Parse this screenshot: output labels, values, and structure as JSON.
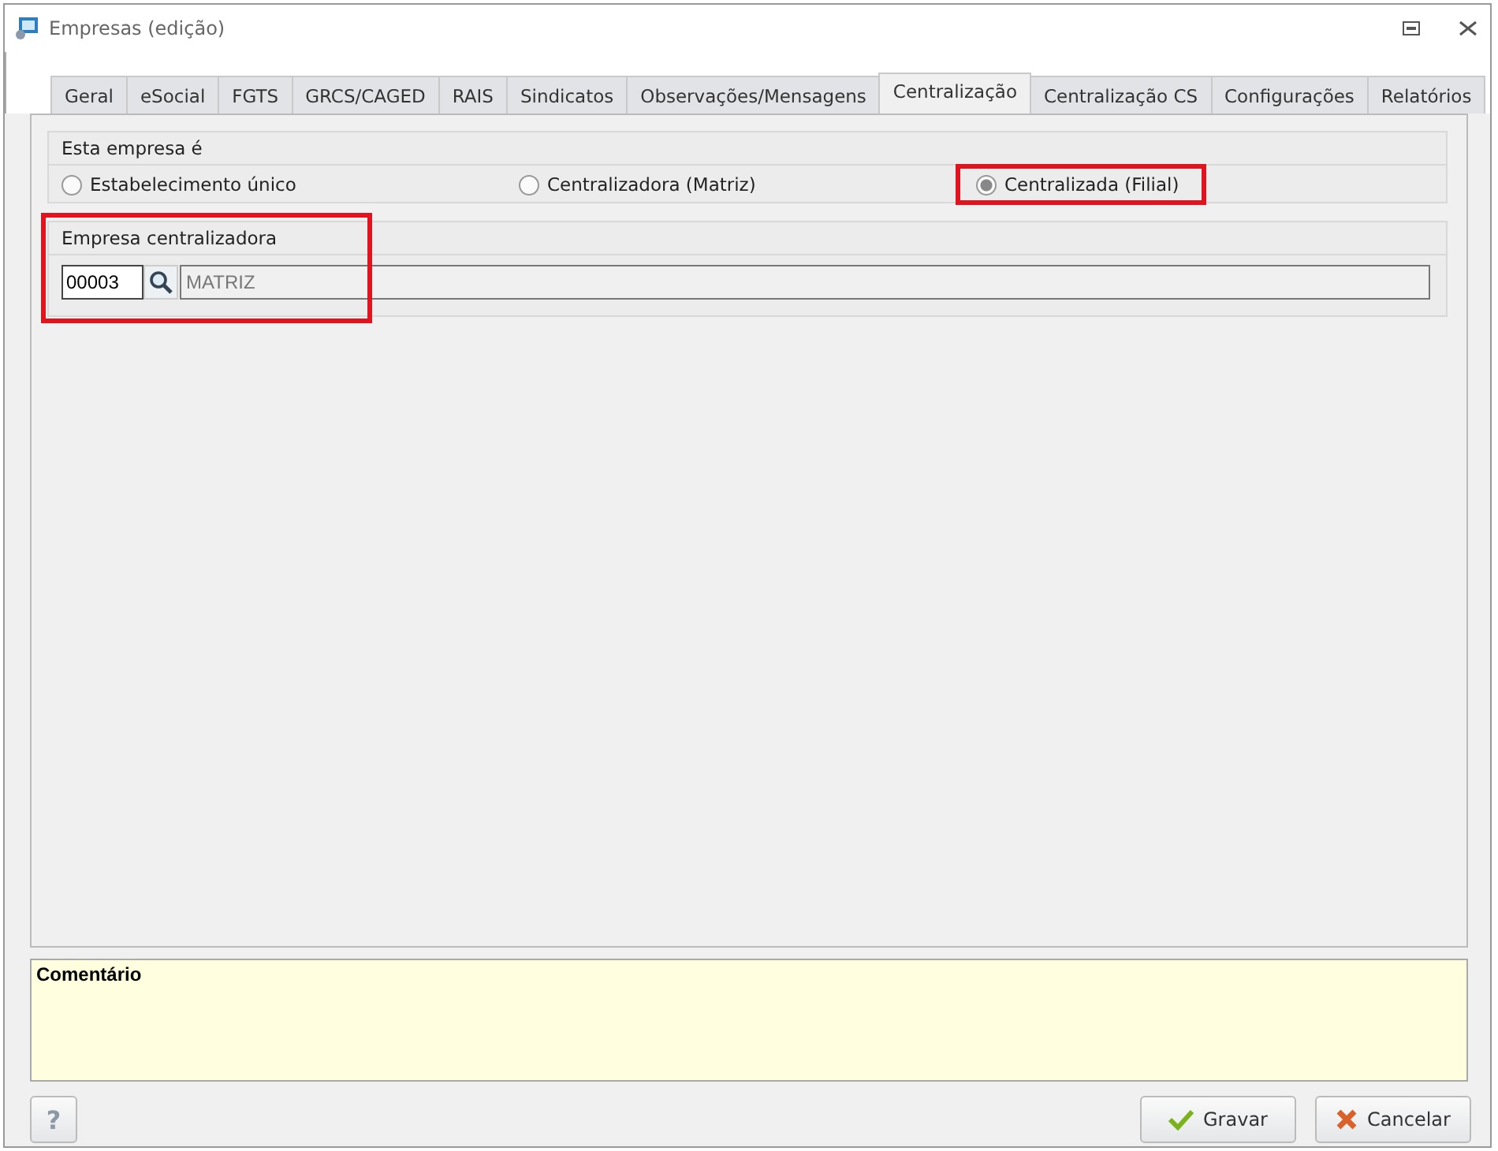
{
  "window": {
    "title": "Empresas (edição)"
  },
  "tabs": [
    {
      "label": "Geral",
      "selected": false
    },
    {
      "label": "eSocial",
      "selected": false
    },
    {
      "label": "FGTS",
      "selected": false
    },
    {
      "label": "GRCS/CAGED",
      "selected": false
    },
    {
      "label": "RAIS",
      "selected": false
    },
    {
      "label": "Sindicatos",
      "selected": false
    },
    {
      "label": "Observações/Mensagens",
      "selected": false
    },
    {
      "label": "Centralização",
      "selected": true
    },
    {
      "label": "Centralização CS",
      "selected": false
    },
    {
      "label": "Configurações",
      "selected": false
    },
    {
      "label": "Relatórios",
      "selected": false
    }
  ],
  "company_type": {
    "label": "Esta empresa é",
    "options": [
      {
        "label": "Estabelecimento único",
        "selected": false,
        "highlighted": false
      },
      {
        "label": "Centralizadora (Matriz)",
        "selected": false,
        "highlighted": false
      },
      {
        "label": "Centralizada (Filial)",
        "selected": true,
        "highlighted": true
      }
    ]
  },
  "central_company": {
    "label": "Empresa centralizadora",
    "highlighted": true,
    "code": "00003",
    "name": "MATRIZ"
  },
  "comment": {
    "label": "Comentário"
  },
  "buttons": [
    {
      "kind": "help",
      "label": "?"
    },
    {
      "kind": "save",
      "label": "Gravar"
    },
    {
      "kind": "cancel",
      "label": "Cancelar"
    }
  ]
}
